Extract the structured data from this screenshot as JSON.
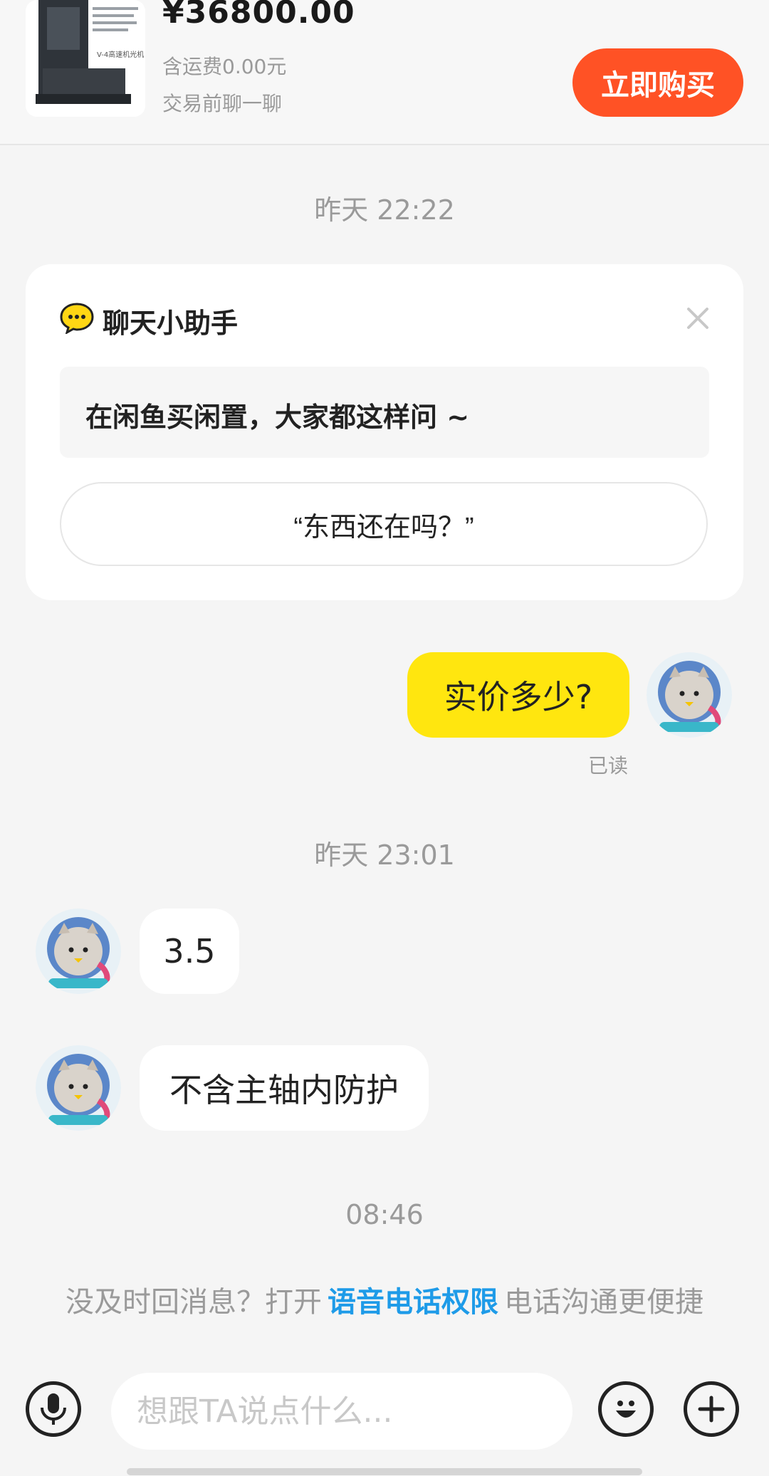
{
  "product": {
    "price": "¥36800.00",
    "shipping": "含运费0.00元",
    "chat_first": "交易前聊一聊",
    "buy_label": "立即购买",
    "image_label": "V-4高速机光机"
  },
  "timestamps": {
    "first": "昨天 22:22",
    "second": "昨天 23:01",
    "third": "08:46"
  },
  "assistant": {
    "title": "聊天小助手",
    "tip": "在闲鱼买闲置，大家都这样问 ~",
    "quick_question": "“东西还在吗？”",
    "close_icon": "close-icon"
  },
  "messages": {
    "mine": {
      "text": "实价多少?",
      "status": "已读"
    },
    "seller": [
      {
        "text": "3.5"
      },
      {
        "text": "不含主轴内防护"
      }
    ]
  },
  "voice_permission": {
    "prefix": "没及时回消息？打开",
    "link": "语音电话权限",
    "suffix": "电话沟通更便捷"
  },
  "input": {
    "placeholder": "想跟TA说点什么..."
  },
  "colors": {
    "accent": "#ff5225",
    "my_bubble": "#ffe60f",
    "link": "#1e9be8"
  }
}
